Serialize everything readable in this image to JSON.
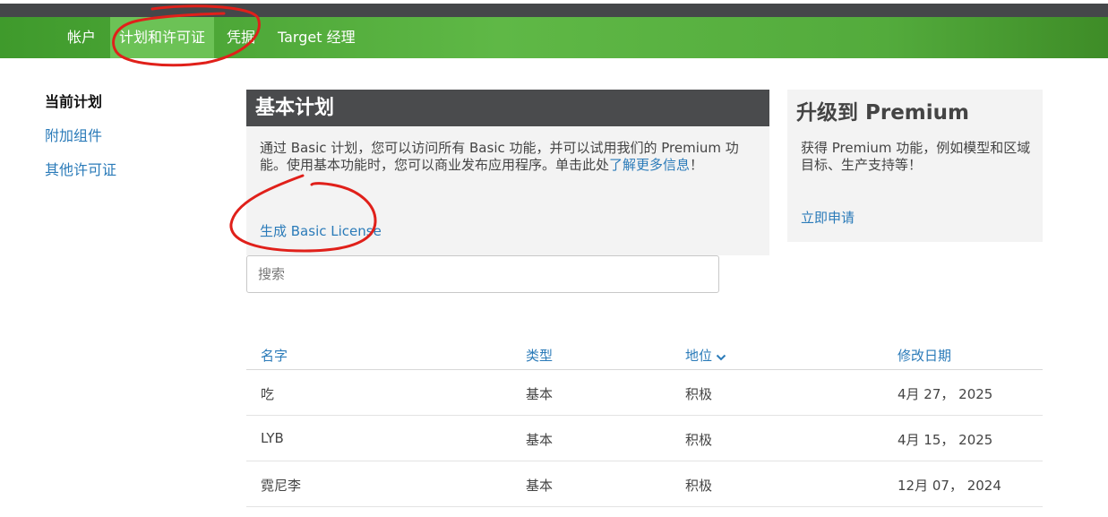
{
  "nav": {
    "items": [
      {
        "label": "帐户"
      },
      {
        "label": "计划和许可证"
      },
      {
        "label": "凭据"
      },
      {
        "label": "Target 经理"
      }
    ]
  },
  "sidebar": {
    "items": [
      {
        "label": "当前计划"
      },
      {
        "label": "附加组件"
      },
      {
        "label": "其他许可证"
      }
    ]
  },
  "plan": {
    "title": "基本计划",
    "desc_part1": "通过 Basic 计划，您可以访问所有 Basic 功能，并可以试用我们的 Premium 功能。使用基本功能时，您可以商业发布应用程序。单击此处",
    "desc_link": "了解更多信息",
    "desc_part2": "！",
    "generate_link": "生成 Basic License"
  },
  "premium": {
    "title": "升级到 Premium",
    "desc": "获得 Premium 功能，例如模型和区域目标、生产支持等！",
    "apply_link": "立即申请"
  },
  "search": {
    "placeholder": "搜索"
  },
  "table": {
    "columns": [
      {
        "label": "名字"
      },
      {
        "label": "类型"
      },
      {
        "label": "地位"
      },
      {
        "label": "修改日期"
      }
    ],
    "rows": [
      {
        "name": "吃",
        "type": "基本",
        "status": "积极",
        "date": "4月 27， 2025"
      },
      {
        "name": "LYB",
        "type": "基本",
        "status": "积极",
        "date": "4月 15， 2025"
      },
      {
        "name": "霓尼李",
        "type": "基本",
        "status": "积极",
        "date": "12月 07， 2024"
      }
    ]
  },
  "colors": {
    "nav_green": "#5fb846",
    "nav_active": "#6cc256",
    "dark_bar": "#45474a",
    "link_blue": "#2b7bb9",
    "annotation_red": "#e0201a"
  }
}
